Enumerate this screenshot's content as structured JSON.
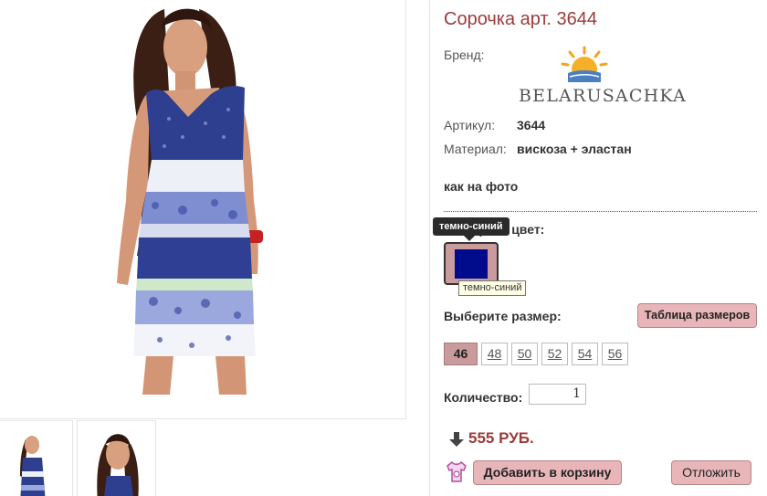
{
  "product": {
    "title": "Сорочка арт. 3644",
    "brand_label": "Бренд:",
    "brand_name": "BELARUSACHKA",
    "article_label": "Артикул:",
    "article_value": "3644",
    "material_label": "Материал:",
    "material_value": "вискоза + эластан",
    "note": "как на фото"
  },
  "color": {
    "label": "Выберите цвет:",
    "tooltip": "темно-синий",
    "swatch_title": "темно-синий",
    "swatch_hex": "#000c8c"
  },
  "size": {
    "label": "Выберите размер:",
    "table_button": "Таблица размеров",
    "options": [
      "46",
      "48",
      "50",
      "52",
      "54",
      "56"
    ],
    "selected": "46"
  },
  "quantity": {
    "label": "Количество:",
    "value": "1"
  },
  "price": {
    "text": "555 РУБ."
  },
  "actions": {
    "add_to_cart": "Добавить в корзину",
    "postpone": "Отложить"
  },
  "colors": {
    "title": "#9b3b3b",
    "button_bg": "#e8b6b8",
    "selected_bg": "#c99b9c"
  }
}
